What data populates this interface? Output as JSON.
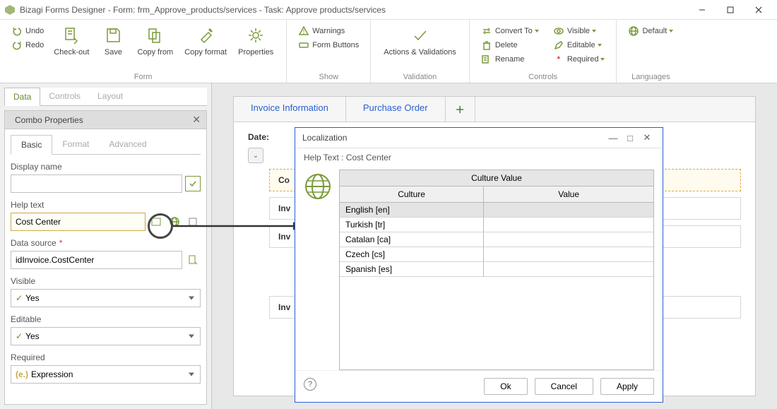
{
  "titlebar": {
    "text": "Bizagi Forms Designer  -  Form: frm_Approve_products/services - Task:  Approve products/services"
  },
  "ribbon": {
    "undo": "Undo",
    "redo": "Redo",
    "checkout": "Check-out",
    "save": "Save",
    "copyfrom": "Copy from",
    "copyformat": "Copy format",
    "properties": "Properties",
    "group_form": "Form",
    "warnings": "Warnings",
    "formbuttons": "Form Buttons",
    "group_show": "Show",
    "actions": "Actions & Validations",
    "group_validation": "Validation",
    "convertto": "Convert To",
    "delete": "Delete",
    "rename": "Rename",
    "visible": "Visible",
    "editable": "Editable",
    "required": "Required",
    "group_controls": "Controls",
    "default": "Default",
    "group_languages": "Languages"
  },
  "side": {
    "tab_data": "Data",
    "tab_controls": "Controls",
    "tab_layout": "Layout",
    "panel_title": "Combo Properties",
    "prop_basic": "Basic",
    "prop_format": "Format",
    "prop_advanced": "Advanced",
    "display_name_label": "Display name",
    "display_name_value": "",
    "help_text_label": "Help text",
    "help_text_value": "Cost Center",
    "data_source_label": "Data source",
    "data_source_value": "idInvoice.CostCenter",
    "visible_label": "Visible",
    "visible_value": "Yes",
    "editable_label": "Editable",
    "editable_value": "Yes",
    "required_label": "Required",
    "required_value": "Expression"
  },
  "form": {
    "tab1": "Invoice Information",
    "tab2": "Purchase Order",
    "date_label": "Date:",
    "row_co": "Co",
    "row_inv1": "Inv",
    "row_inv2": "Inv",
    "row_inv3": "Inv"
  },
  "dialog": {
    "title": "Localization",
    "subtitle": "Help Text : Cost Center",
    "table_header": "Culture Value",
    "col_culture": "Culture",
    "col_value": "Value",
    "rows": [
      {
        "culture": "English [en]",
        "value": ""
      },
      {
        "culture": "Turkish [tr]",
        "value": ""
      },
      {
        "culture": "Catalan [ca]",
        "value": ""
      },
      {
        "culture": "Czech [cs]",
        "value": ""
      },
      {
        "culture": "Spanish [es]",
        "value": ""
      }
    ],
    "ok": "Ok",
    "cancel": "Cancel",
    "apply": "Apply"
  }
}
